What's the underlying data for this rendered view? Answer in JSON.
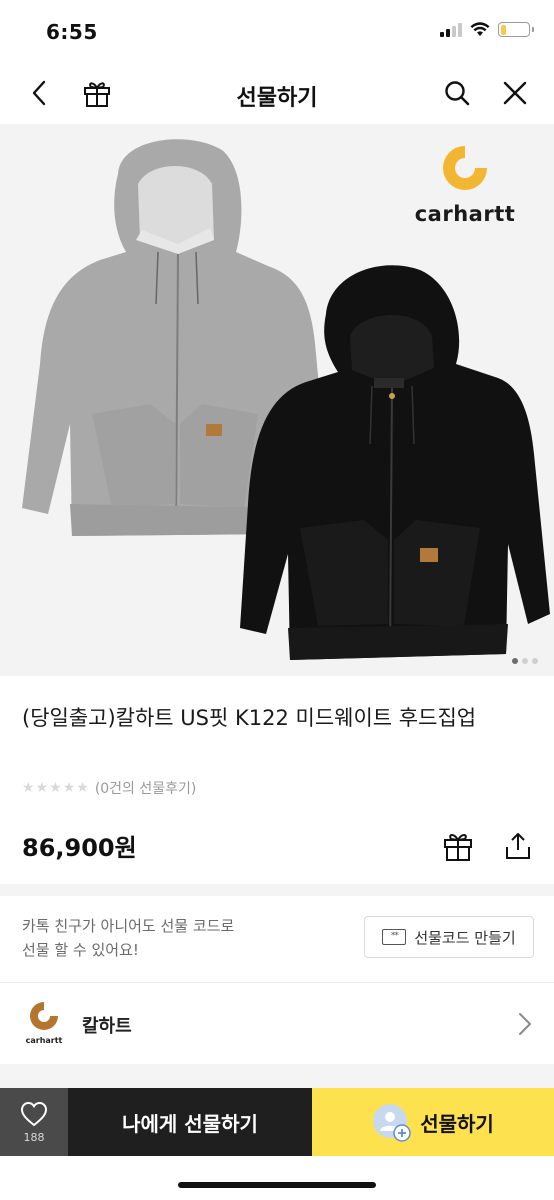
{
  "status_bar": {
    "time": "6:55",
    "battery_level_percent": 18
  },
  "header": {
    "title": "선물하기",
    "back_icon": "chevron-left-icon",
    "gift_icon": "gift-icon",
    "search_icon": "search-icon",
    "close_icon": "close-icon"
  },
  "product_image": {
    "brand_text": "carhartt",
    "brand_color": "#f2b632",
    "gray_hoodie_color": "#a9a9a9",
    "black_hoodie_color": "#111111",
    "dots": [
      true,
      false,
      false
    ]
  },
  "product": {
    "title": "(당일출고)칼하트 US핏 K122 미드웨이트 후드집업",
    "rating_stars": 0,
    "review_text": "(0건의 선물후기)",
    "price": "86,900원"
  },
  "gift_code": {
    "description_line1": "카톡 친구가 아니어도 선물 코드로",
    "description_line2": "선물 할 수 있어요!",
    "button_label": "선물코드 만들기",
    "button_icon_text": "**"
  },
  "brand": {
    "name": "칼하트",
    "logo_text": "carhartt"
  },
  "bottom_bar": {
    "like_count": "188",
    "self_gift_label": "나에게 선물하기",
    "gift_label": "선물하기",
    "accent": "#fde14e"
  }
}
